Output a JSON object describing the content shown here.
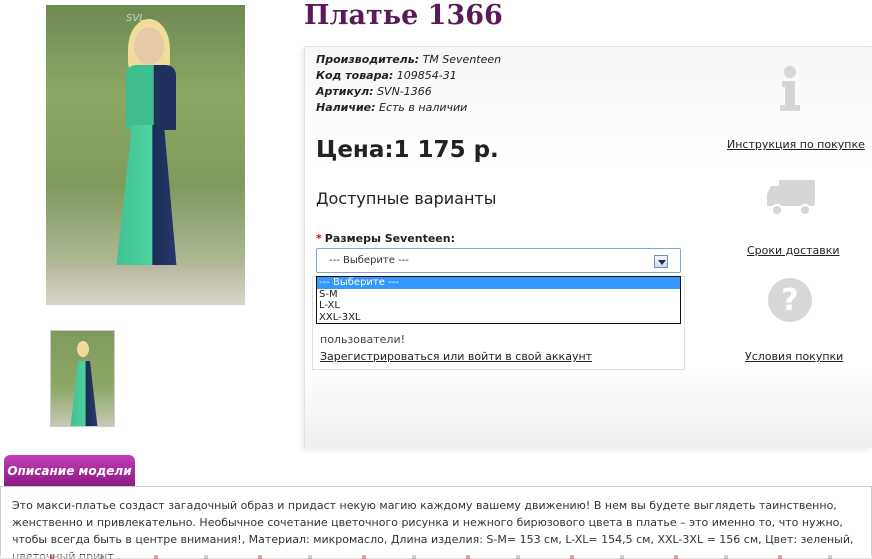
{
  "product": {
    "title": "Платье 1366",
    "watermark": "SVL"
  },
  "meta": {
    "manufacturer_label": "Производитель:",
    "manufacturer_value": "TM Seventeen",
    "code_label": "Код товара:",
    "code_value": "109854-31",
    "article_label": "Артикул:",
    "article_value": "SVN-1366",
    "stock_label": "Наличие:",
    "stock_value": "Есть в наличии"
  },
  "price": "Цена:1 175 р.",
  "variants": {
    "title": "Доступные варианты",
    "size_label": "Размеры Seventeen:",
    "required_mark": "*",
    "select_value": "--- Выберите ---",
    "options": [
      "--- Выберите ---",
      "S-M",
      "L-XL",
      "XXL-3XL"
    ]
  },
  "guest": {
    "text": "пользователи!",
    "register_link": "Зарегистрироваться или войти в свой аккаунт"
  },
  "side": {
    "purchase_instructions": "Инструкция по покупке",
    "delivery_terms": "Сроки доставки",
    "purchase_conditions": "Условия покупки",
    "info_icon": "info-icon",
    "truck_icon": "truck-icon",
    "question_icon": "question-icon"
  },
  "description": {
    "tab_label": "Описание модели",
    "text": "Это макси-платье создаст загадочный образ и придаст некую магию каждому вашему движению! В нем вы будете выглядеть таинственно, женственно и привлекательно. Необычное сочетание цветочного рисунка и нежного бирюзового цвета в платье – это именно то, что нужно, чтобы всегда быть в центре внимания!, Материал: микромасло, Длина изделия: S-M= 153 см, L-XL= 154,5 см, XXL-3XL = 156 см, Цвет: зеленый, цветочный принт"
  }
}
